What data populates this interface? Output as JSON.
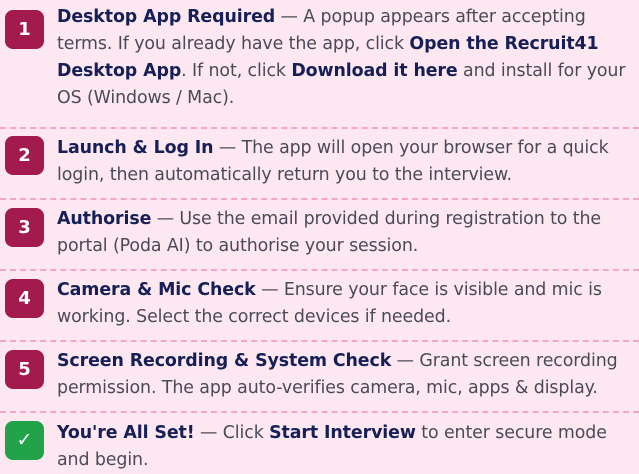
{
  "steps": [
    {
      "badge": "1",
      "title": "Desktop App Required",
      "sep": " — ",
      "t1": "A popup appears after accepting terms. If you already have the app, click ",
      "b1": "Open the Recruit41 Desktop App",
      "t2": ". If not, click ",
      "b2": "Download it here",
      "t3": " and install for your OS (Windows / Mac)."
    },
    {
      "badge": "2",
      "title": "Launch & Log In",
      "sep": " — ",
      "t1": "The app will open your browser for a quick login, then automatically return you to the interview."
    },
    {
      "badge": "3",
      "title": "Authorise",
      "sep": " — ",
      "t1": "Use the email provided during registration to the portal (Poda AI) to authorise your session."
    },
    {
      "badge": "4",
      "title": "Camera & Mic Check",
      "sep": " — ",
      "t1": "Ensure your face is visible and mic is working. Select the correct devices if needed."
    },
    {
      "badge": "5",
      "title": "Screen Recording & System Check",
      "sep": " — ",
      "t1": "Grant screen recording permission. The app auto-verifies camera, mic, apps & display."
    },
    {
      "badge": "✓",
      "title": "You're All Set!",
      "sep": " — ",
      "t1": "Click ",
      "b1": "Start Interview",
      "t2": " to enter secure mode and begin."
    }
  ],
  "colors": {
    "background": "#fde8f2",
    "badge": "#a21a4e",
    "badge_done": "#22a34a",
    "heading": "#172056",
    "body_text": "#4a4a57",
    "divider": "#f4a6c8"
  },
  "icons": {
    "done_badge": "checkmark-icon"
  }
}
